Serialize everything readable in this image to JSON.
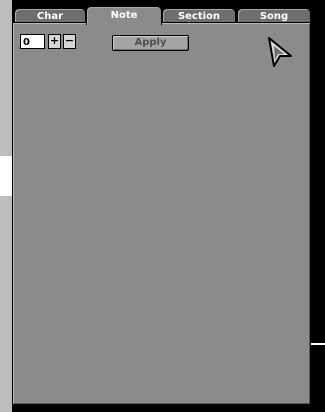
{
  "tabs": [
    {
      "label": "Char",
      "active": false
    },
    {
      "label": "Note",
      "active": true
    },
    {
      "label": "Section",
      "active": false
    },
    {
      "label": "Song",
      "active": false
    }
  ],
  "controls": {
    "value_field": "0",
    "increment_label": "+",
    "decrement_label": "−",
    "apply_label": "Apply"
  },
  "icons": {
    "pointer": "arrow-cursor-icon"
  },
  "colors": {
    "panel": "#8b8b8b",
    "tab": "#6e6e6e",
    "apply_text": "#505050"
  }
}
